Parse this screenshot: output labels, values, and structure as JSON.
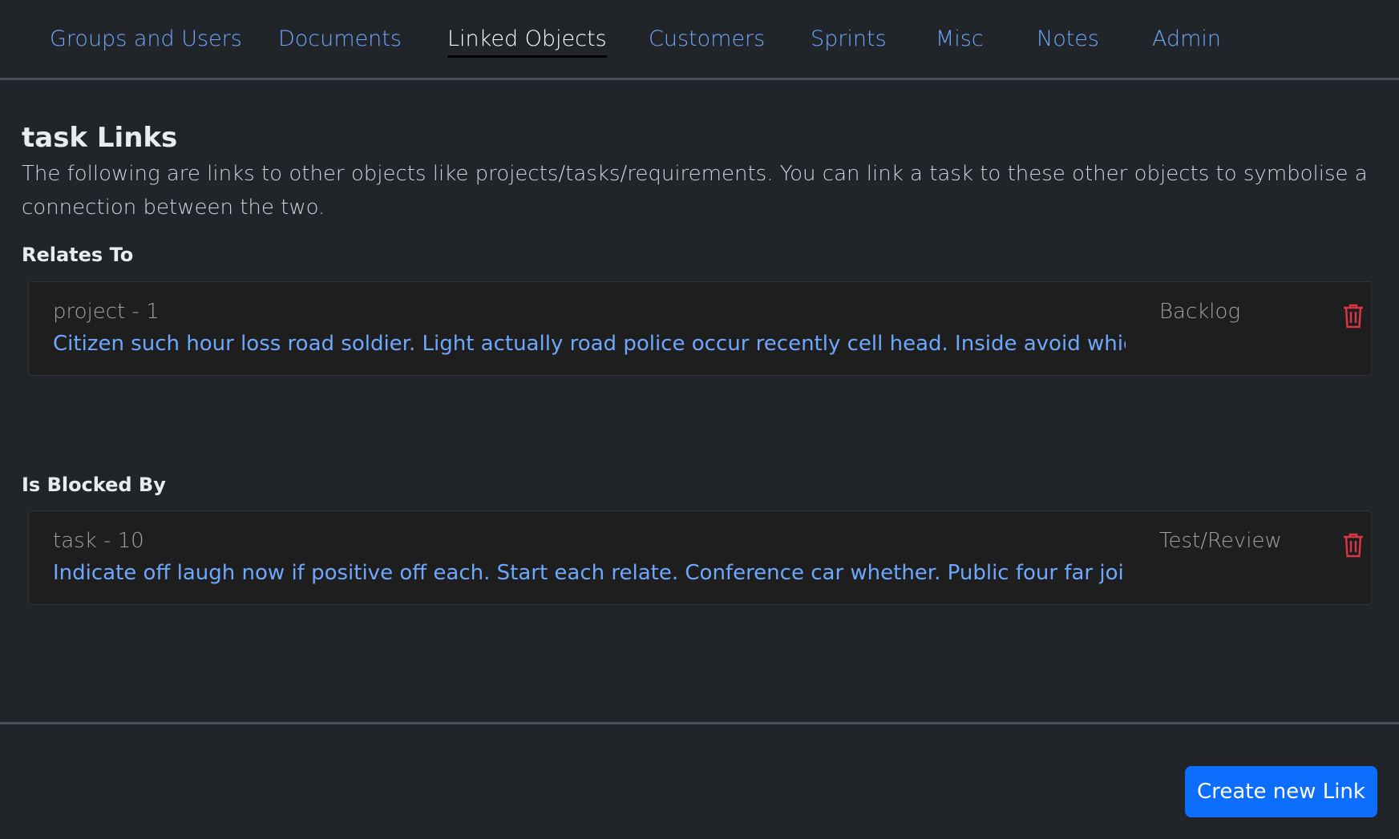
{
  "tabs": [
    {
      "label": "Groups and Users"
    },
    {
      "label": "Documents"
    },
    {
      "label": "Linked Objects"
    },
    {
      "label": "Customers"
    },
    {
      "label": "Sprints"
    },
    {
      "label": "Misc"
    },
    {
      "label": "Notes"
    },
    {
      "label": "Admin"
    }
  ],
  "active_tab": "Linked Objects",
  "main": {
    "title": "task Links",
    "description": "The following are links to other objects like projects/tasks/requirements. You can link a task to these other objects to symbolise a connection between the two."
  },
  "sections": [
    {
      "label": "Relates To",
      "item": {
        "ref": "project - 1",
        "summary": "Citizen such hour loss road soldier. Light actually road police occur recently cell head. Inside avoid which off he",
        "status": "Backlog",
        "delete_icon": "trash-icon"
      }
    },
    {
      "label": "Is Blocked By",
      "item": {
        "ref": "task - 10",
        "summary": "Indicate off laugh now if positive off each. Start each relate. Conference car whether. Public four far join. Inter",
        "status": "Test/Review",
        "delete_icon": "trash-icon"
      }
    }
  ],
  "footer": {
    "create_label": "Create new Link"
  },
  "colors": {
    "background": "#212529",
    "link": "#6ea8fe",
    "primary_button": "#0d6efd",
    "danger": "#dc3545"
  }
}
